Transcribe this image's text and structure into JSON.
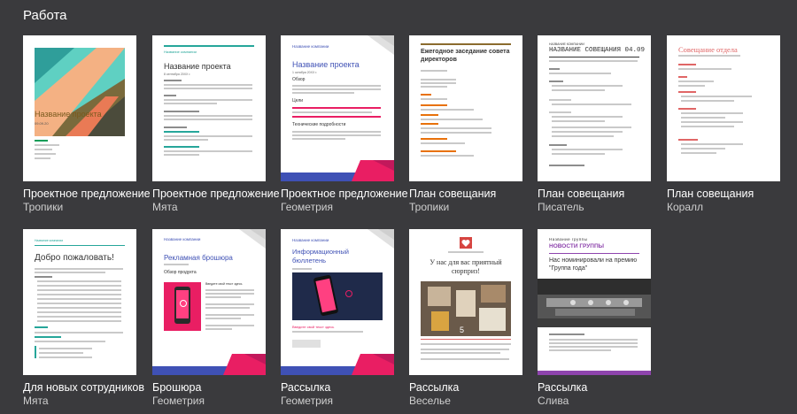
{
  "section": {
    "title": "Работа"
  },
  "templates": [
    {
      "name": "Проектное предложение",
      "theme": "Тропики",
      "preview": {
        "title": "Название проекта",
        "date": "09.09.20"
      }
    },
    {
      "name": "Проектное предложение",
      "theme": "Мята",
      "preview": {
        "company": "Название компании",
        "title": "Название проекта",
        "date": "8 сентября 20XX г."
      }
    },
    {
      "name": "Проектное предложение",
      "theme": "Геометрия",
      "preview": {
        "company": "Название компании",
        "title": "Название проекта",
        "date": "1 октября 20XX г.",
        "h1": "Обзор",
        "h2": "Цели",
        "h3": "Технические подробности"
      }
    },
    {
      "name": "План совещания",
      "theme": "Тропики",
      "preview": {
        "title": "Ежегодное заседание совета директоров"
      }
    },
    {
      "name": "План совещания",
      "theme": "Писатель",
      "preview": {
        "company": "НАЗВАНИЕ КОМПАНИИ",
        "title": "НАЗВАНИЕ СОВЕЩАНИЯ 04.09"
      }
    },
    {
      "name": "План совещания",
      "theme": "Коралл",
      "preview": {
        "title": "Совещание отдела"
      }
    },
    {
      "name": "Для новых сотрудников",
      "theme": "Мята",
      "preview": {
        "company": "Название компании",
        "title": "Добро пожаловать!"
      }
    },
    {
      "name": "Брошюра",
      "theme": "Геометрия",
      "preview": {
        "company": "Название компании",
        "title": "Рекламная брошюра",
        "h1": "Обзор продукта",
        "caption": "Введите свой текст здесь"
      }
    },
    {
      "name": "Рассылка",
      "theme": "Геометрия",
      "preview": {
        "company": "Название компании",
        "title": "Информационный бюллетень",
        "caption": "Введите свой текст здесь"
      }
    },
    {
      "name": "Рассылка",
      "theme": "Веселье",
      "preview": {
        "title": "У нас для вас приятный сюрприз!"
      }
    },
    {
      "name": "Рассылка",
      "theme": "Слива",
      "preview": {
        "group": "Название группы",
        "title": "НОВОСТИ ГРУППЫ",
        "headline": "Нас номинировали на премию \"Группа года\""
      }
    }
  ],
  "colors": {
    "background": "#3a3a3d",
    "tropics_green": "#0f9d58",
    "tropics_orange": "#e8710a",
    "mint": "#26a69a",
    "geometry_blue": "#3f51b5",
    "geometry_pink": "#e91e63",
    "coral": "#e06666",
    "plum": "#8e44ad"
  },
  "icons": [
    "heart-icon",
    "tile-thumbnail"
  ]
}
